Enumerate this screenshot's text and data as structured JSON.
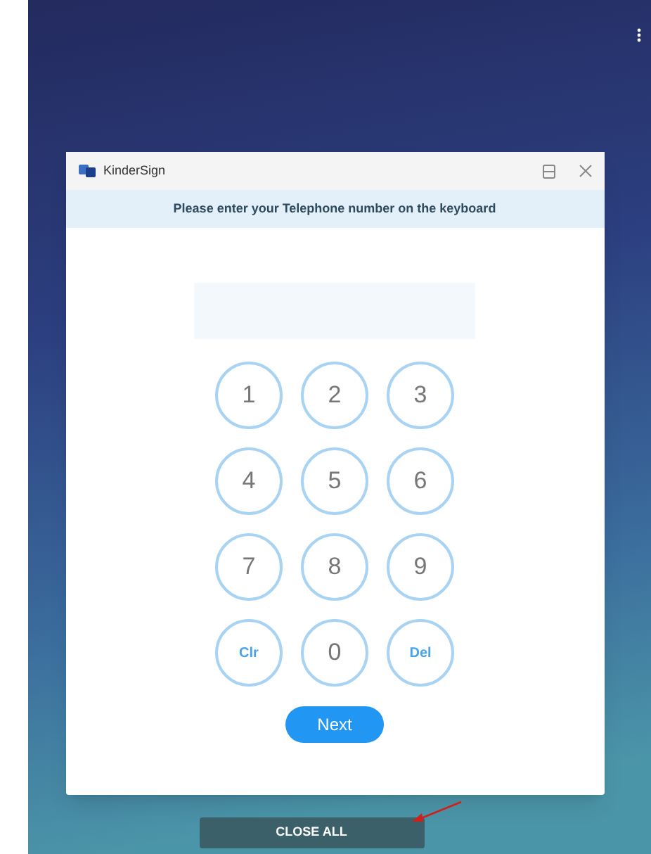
{
  "window": {
    "title": "KinderSign"
  },
  "banner": "Please enter your Telephone number on the keyboard",
  "keypad": [
    {
      "label": "1",
      "kind": "digit"
    },
    {
      "label": "2",
      "kind": "digit"
    },
    {
      "label": "3",
      "kind": "digit"
    },
    {
      "label": "4",
      "kind": "digit"
    },
    {
      "label": "5",
      "kind": "digit"
    },
    {
      "label": "6",
      "kind": "digit"
    },
    {
      "label": "7",
      "kind": "digit"
    },
    {
      "label": "8",
      "kind": "digit"
    },
    {
      "label": "9",
      "kind": "digit"
    },
    {
      "label": "Clr",
      "kind": "action"
    },
    {
      "label": "0",
      "kind": "digit"
    },
    {
      "label": "Del",
      "kind": "action"
    }
  ],
  "next_button": "Next",
  "close_all_button": "CLOSE ALL"
}
